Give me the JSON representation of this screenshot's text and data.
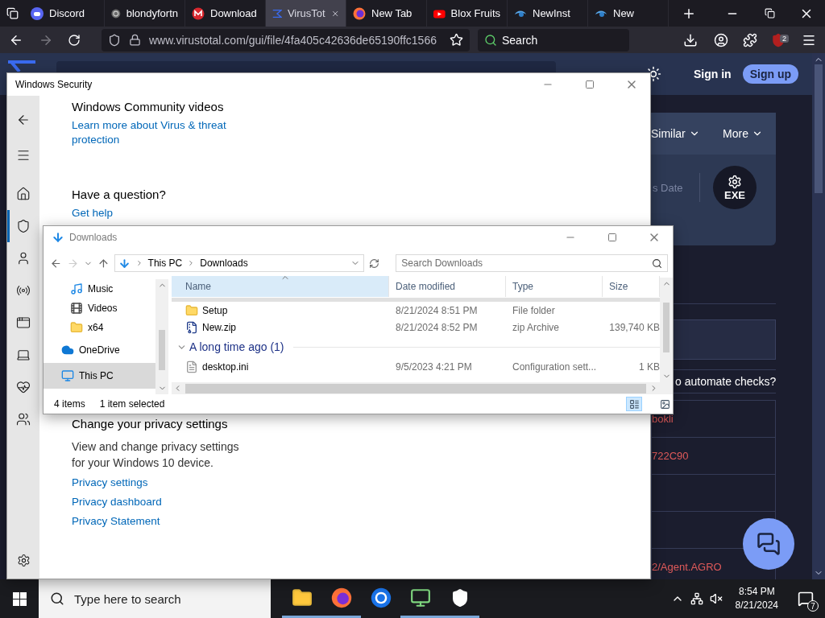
{
  "browser": {
    "tabs": [
      {
        "label": "Discord",
        "kind": "discord",
        "selected": false
      },
      {
        "label": "blondyfortn",
        "kind": "generic",
        "selected": false
      },
      {
        "label": "Download",
        "kind": "mega",
        "selected": false
      },
      {
        "label": "VirusTot",
        "kind": "virustotal",
        "selected": true
      },
      {
        "label": "New Tab",
        "kind": "firefox",
        "selected": false
      },
      {
        "label": "Blox Fruits",
        "kind": "video",
        "selected": false
      },
      {
        "label": "NewInst",
        "kind": "swirl",
        "selected": false
      },
      {
        "label": "New",
        "kind": "swirl",
        "selected": false
      }
    ],
    "url": "www.virustotal.com/gui/file/4fa405c42636de65190ffc1566",
    "search_placeholder": "Search",
    "extension_badge": "2"
  },
  "virustotal": {
    "sign_in": "Sign in",
    "sign_up": "Sign up",
    "menu": [
      "Similar",
      "More"
    ],
    "column_fragment": "s Date",
    "file_badge": "EXE",
    "prompt_fragment": "o automate checks?",
    "rows": [
      {
        "text": "bokli"
      },
      {
        "text": "722C90"
      },
      {},
      {},
      {
        "text": "2/Agent.AGRO"
      }
    ]
  },
  "windows_security": {
    "title": "Windows Security",
    "nav_items": [
      {
        "kind": "home",
        "selected": false
      },
      {
        "kind": "shield",
        "selected": true
      },
      {
        "kind": "account",
        "selected": false
      },
      {
        "kind": "network",
        "selected": false
      },
      {
        "kind": "app",
        "selected": false
      },
      {
        "kind": "device",
        "selected": false
      },
      {
        "kind": "health",
        "selected": false
      },
      {
        "kind": "family",
        "selected": false
      }
    ],
    "upper_sections": [
      {
        "heading": "Windows Community videos",
        "links": [
          "Learn more about Virus & threat protection"
        ]
      },
      {
        "heading": "Have a question?",
        "links": [
          "Get help"
        ]
      }
    ],
    "lower_sections": [
      {
        "heading": "Change your privacy settings",
        "body": "View and change privacy settings for your Windows 10 device.",
        "links": [
          "Privacy settings",
          "Privacy dashboard",
          "Privacy Statement"
        ]
      }
    ]
  },
  "explorer": {
    "title": "Downloads",
    "path": [
      "This PC",
      "Downloads"
    ],
    "search_placeholder": "Search Downloads",
    "nav": [
      {
        "label": "Music",
        "kind": "music",
        "selected": false
      },
      {
        "label": "Videos",
        "kind": "videos",
        "selected": false
      },
      {
        "label": "x64",
        "kind": "folder",
        "selected": false
      },
      {
        "label": "OneDrive",
        "kind": "onedrive",
        "selected": false
      },
      {
        "label": "This PC",
        "kind": "pc",
        "selected": true
      }
    ],
    "columns": [
      {
        "label": "Name",
        "sorted": true
      },
      {
        "label": "Date modified",
        "sorted": false
      },
      {
        "label": "Type",
        "sorted": false
      },
      {
        "label": "Size",
        "sorted": false
      }
    ],
    "items": [
      {
        "kind": "folder",
        "name": "Setup",
        "date": "8/21/2024 8:51 PM",
        "type": "File folder",
        "selected": false
      },
      {
        "kind": "zip",
        "name": "New.zip",
        "date": "8/21/2024 8:52 PM",
        "type": "zip Archive",
        "size": "139,740 KB",
        "selected": false
      },
      {
        "kind": "group",
        "label": "A long time ago (1)",
        "expanded": true,
        "children": [
          {
            "kind": "file",
            "name": "desktop.ini",
            "date": "9/5/2023 4:21 PM",
            "type": "Configuration sett...",
            "size": "1 KB",
            "selected": false
          }
        ]
      }
    ],
    "status": [
      "4 items",
      "1 item selected"
    ]
  },
  "taskbar": {
    "search_placeholder": "Type here to search",
    "apps": [
      {
        "kind": "explorer",
        "running": true
      },
      {
        "kind": "firefox",
        "running": true
      },
      {
        "kind": "chrome",
        "running": false
      },
      {
        "kind": "monitor",
        "running": true
      },
      {
        "kind": "security",
        "running": true
      }
    ],
    "time": "8:54 PM",
    "date": "8/21/2024",
    "notification_count": "7"
  }
}
